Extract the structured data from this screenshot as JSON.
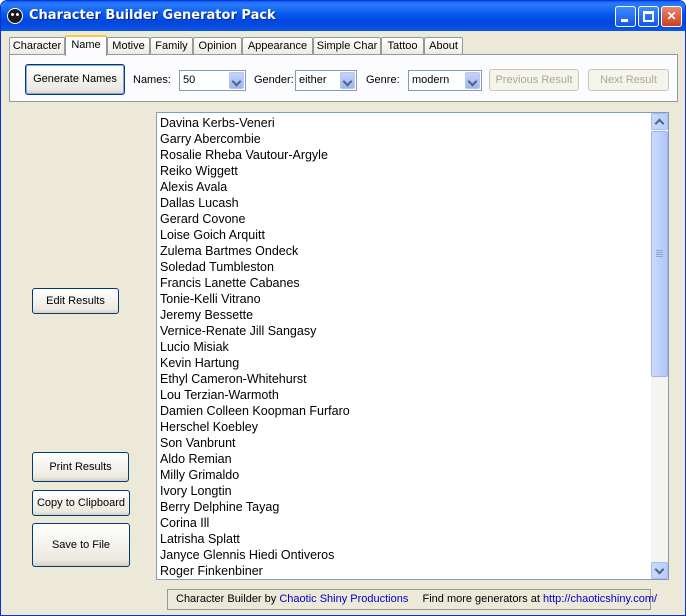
{
  "window": {
    "title": "Character Builder Generator Pack"
  },
  "tabs": [
    {
      "label": "Character"
    },
    {
      "label": "Name"
    },
    {
      "label": "Motive"
    },
    {
      "label": "Family"
    },
    {
      "label": "Opinion"
    },
    {
      "label": "Appearance"
    },
    {
      "label": "Simple Char"
    },
    {
      "label": "Tattoo"
    },
    {
      "label": "About"
    }
  ],
  "active_tab": "Name",
  "toolbar": {
    "generate_label": "Generate Names",
    "names_label": "Names:",
    "names_value": "50",
    "gender_label": "Gender:",
    "gender_value": "either",
    "genre_label": "Genre:",
    "genre_value": "modern",
    "previous_label": "Previous Result",
    "next_label": "Next Result"
  },
  "side_buttons": {
    "edit": "Edit Results",
    "print": "Print Results",
    "copy": "Copy to Clipboard",
    "save": "Save to File"
  },
  "results": [
    "Davina Kerbs-Veneri",
    "Garry Abercombie",
    "Rosalie Rheba Vautour-Argyle",
    "Reiko Wiggett",
    "Alexis Avala",
    "Dallas Lucash",
    "Gerard Covone",
    "Loise Goich Arquitt",
    "Zulema Bartmes Ondeck",
    "Soledad Tumbleston",
    "Francis Lanette Cabanes",
    "Tonie-Kelli Vitrano",
    "Jeremy Bessette",
    "Vernice-Renate Jill Sangasy",
    "Lucio Misiak",
    "Kevin Hartung",
    "Ethyl Cameron-Whitehurst",
    "Lou Terzian-Warmoth",
    "Damien Colleen Koopman Furfaro",
    "Herschel Koebley",
    "Son Vanbrunt",
    "Aldo Remian",
    "Milly Grimaldo",
    "Ivory Longtin",
    "Berry Delphine Tayag",
    "Corina Ill",
    "Latrisha Splatt",
    "Janyce Glennis Hiedi Ontiveros",
    "Roger Finkenbiner"
  ],
  "status": {
    "prefix": "Character Builder by",
    "company": "Chaotic Shiny Productions",
    "middle": "Find more generators at",
    "url": "http://chaoticshiny.com/"
  }
}
